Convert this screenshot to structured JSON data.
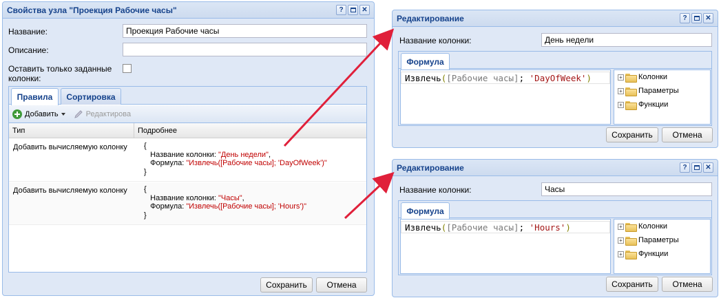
{
  "main_window": {
    "title": "Свойства узла \"Проекция Рабочие часы\"",
    "name_label": "Название:",
    "name_value": "Проекция Рабочие часы",
    "description_label": "Описание:",
    "description_value": "",
    "keep_only_label_line1": "Оставить только заданные",
    "keep_only_label_line2": "колонки:",
    "keep_only_checked": false,
    "tabs": [
      {
        "label": "Правила",
        "active": true
      },
      {
        "label": "Сортировка",
        "active": false
      }
    ],
    "toolbar": {
      "add_label": "Добавить",
      "edit_label": "Редактирова"
    },
    "grid": {
      "columns": [
        "Тип",
        "Подробнее"
      ],
      "rows": [
        {
          "type": "Добавить вычисляемую колонку",
          "open_brace": "{",
          "name_key": "Название колонки: ",
          "name_value": "\"День недели\"",
          "name_comma": ",",
          "formula_key": "Формула: ",
          "formula_value": "\"Извлечь([Рабочие часы]; 'DayOfWeek')\"",
          "close_brace": "}"
        },
        {
          "type": "Добавить вычисляемую колонку",
          "open_brace": "{",
          "name_key": "Название колонки: ",
          "name_value": "\"Часы\"",
          "name_comma": ",",
          "formula_key": "Формула: ",
          "formula_value": "\"Извлечь([Рабочие часы]; 'Hours')\"",
          "close_brace": "}"
        }
      ]
    },
    "save_label": "Сохранить",
    "cancel_label": "Отмена"
  },
  "edit_windows": [
    {
      "title": "Редактирование",
      "column_name_label": "Название колонки:",
      "column_name_value": "День недели",
      "formula_tab": "Формула",
      "code_fn": "Извлечь",
      "code_open": "(",
      "code_col": "[Рабочие часы]",
      "code_sep": "; ",
      "code_lit": "'DayOfWeek'",
      "code_close": ")",
      "tree": [
        "Колонки",
        "Параметры",
        "Функции"
      ],
      "save_label": "Сохранить",
      "cancel_label": "Отмена"
    },
    {
      "title": "Редактирование",
      "column_name_label": "Название колонки:",
      "column_name_value": "Часы",
      "formula_tab": "Формула",
      "code_fn": "Извлечь",
      "code_open": "(",
      "code_col": "[Рабочие часы]",
      "code_sep": "; ",
      "code_lit": "'Hours'",
      "code_close": ")",
      "tree": [
        "Колонки",
        "Параметры",
        "Функции"
      ],
      "save_label": "Сохранить",
      "cancel_label": "Отмена"
    }
  ],
  "tools": {
    "help": "?",
    "close": "✕"
  },
  "colors": {
    "header_text": "#15428b",
    "string_value": "#c00000",
    "arrow": "#e0203a",
    "border": "#99bbe8"
  }
}
